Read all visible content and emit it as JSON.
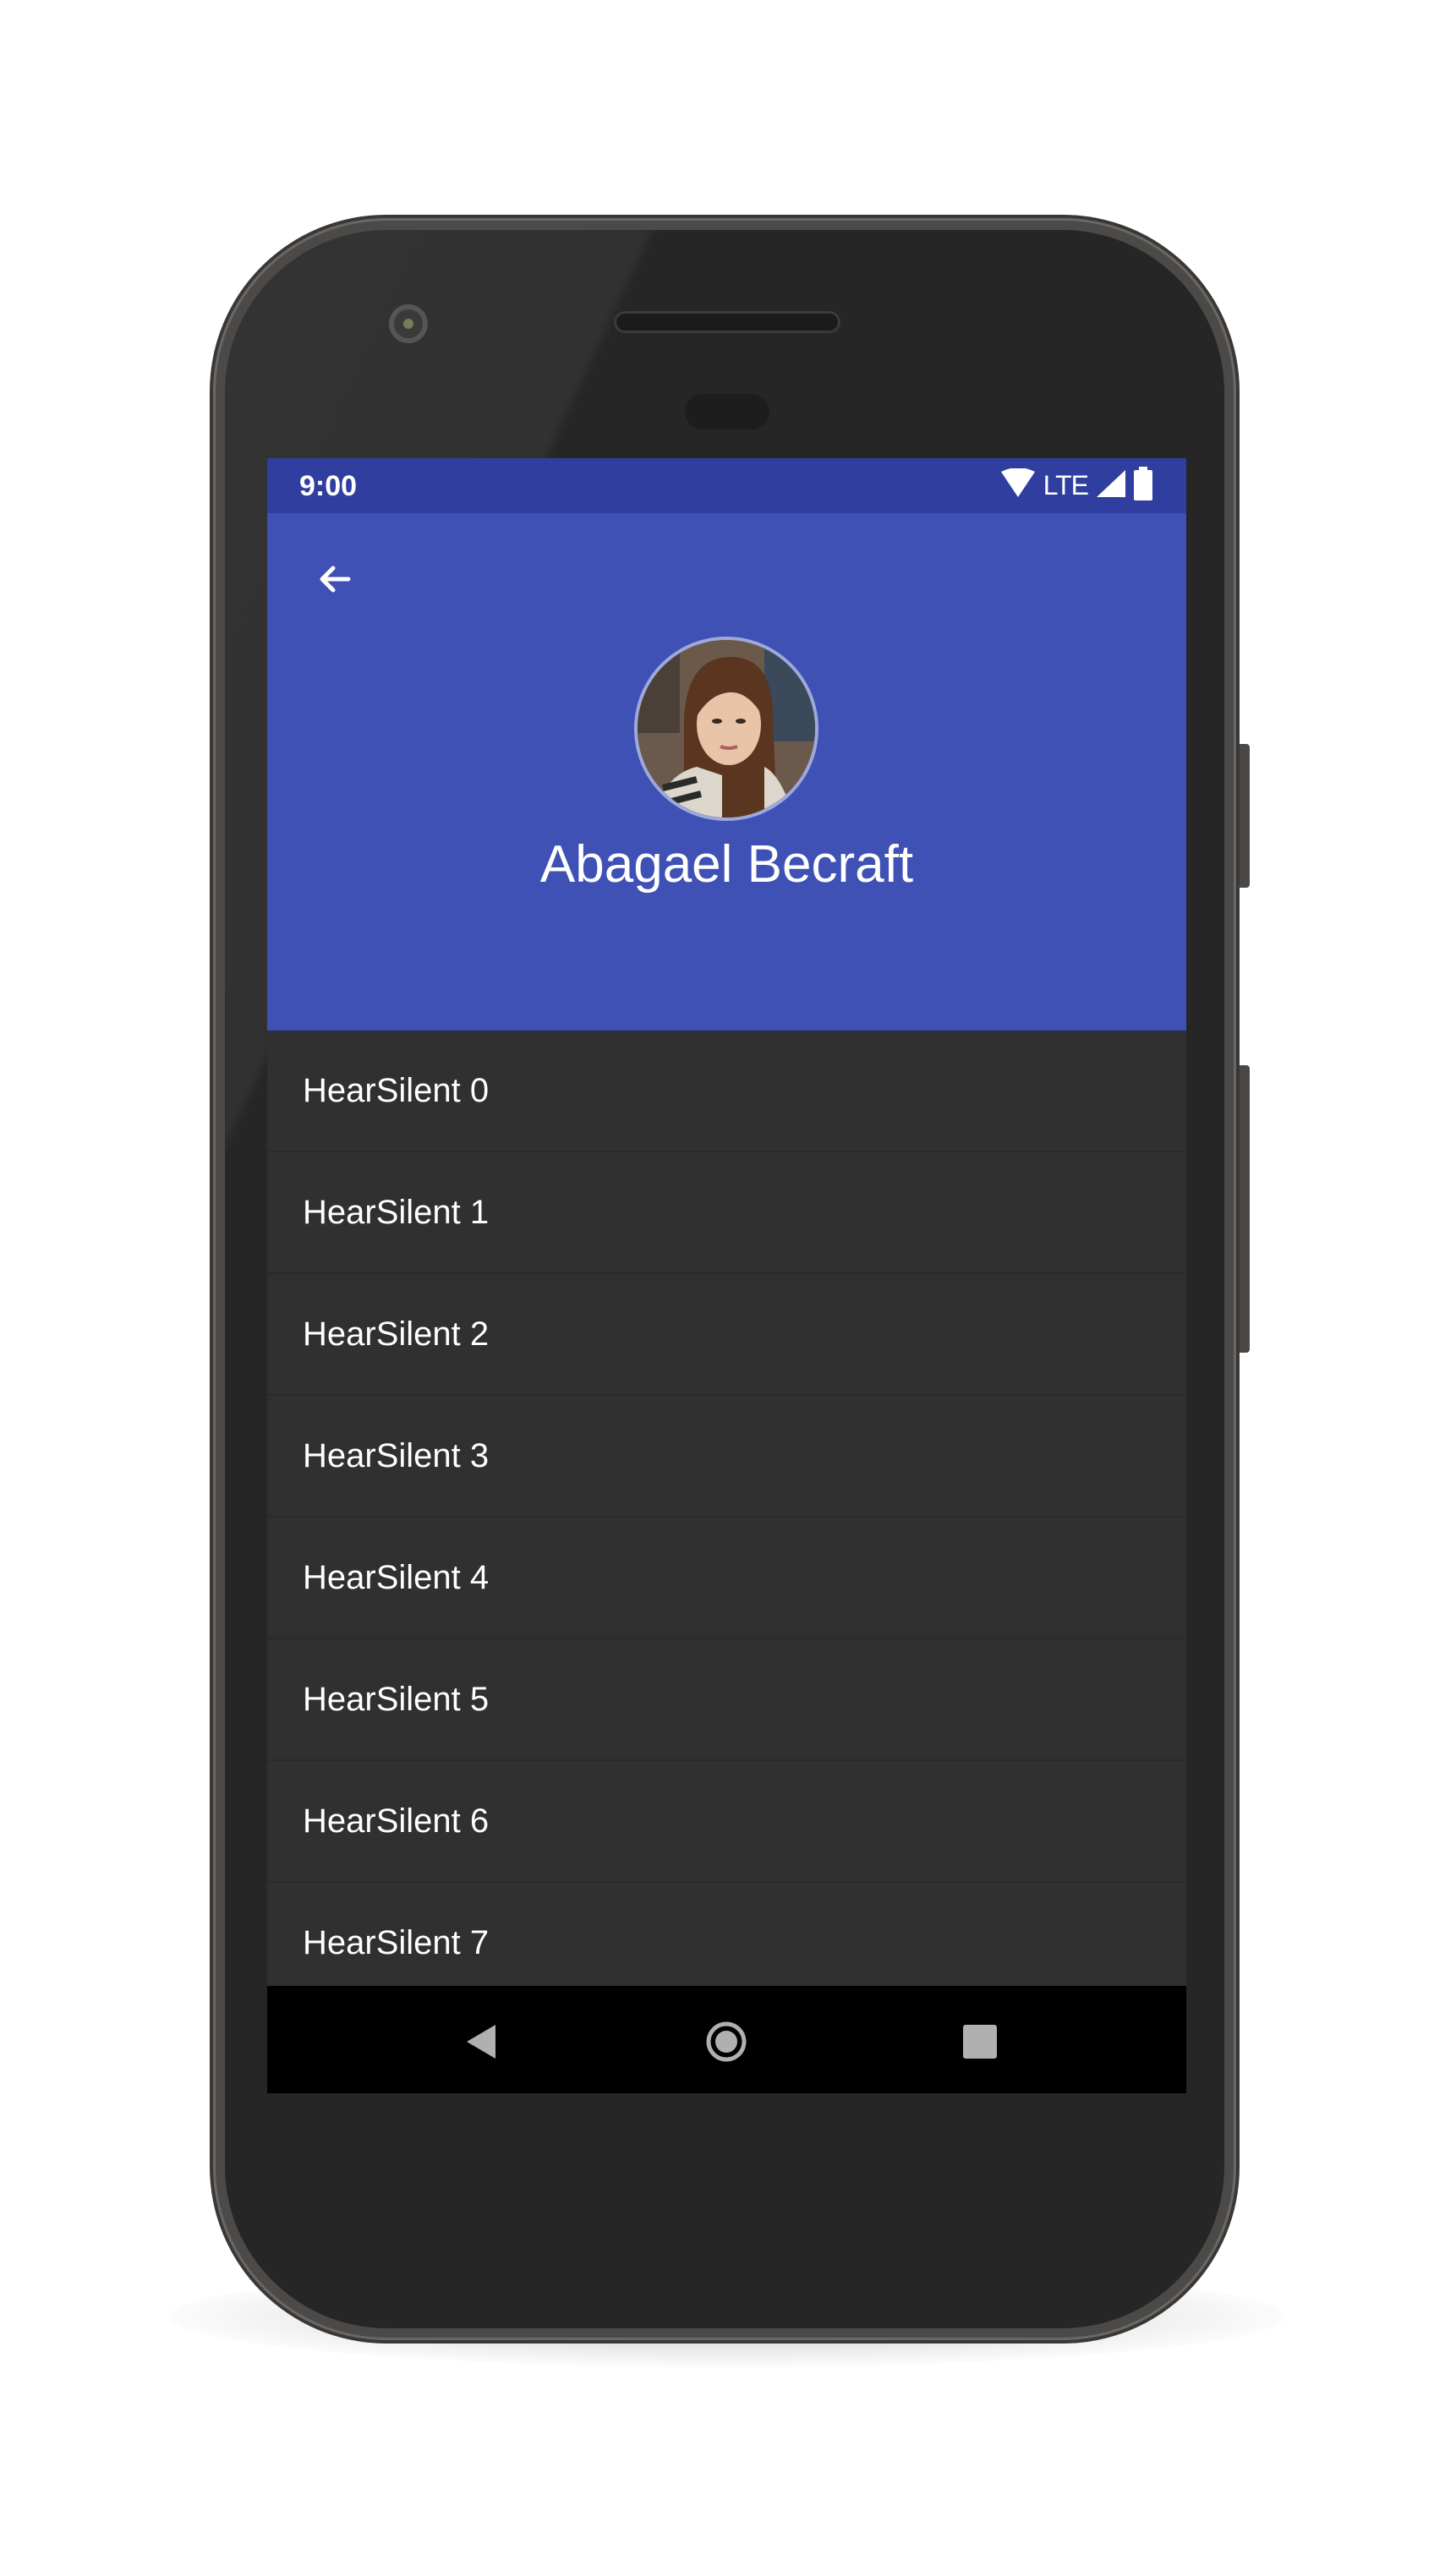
{
  "status_bar": {
    "time": "9:00",
    "network": "LTE",
    "icons": [
      "wifi-icon",
      "signal-icon",
      "battery-icon"
    ]
  },
  "header": {
    "back_icon": "arrow-back-icon",
    "profile_name": "Abagael Becraft",
    "background_color": "#3f51b5",
    "status_bar_color": "#303f9f"
  },
  "list": {
    "items": [
      {
        "label": "HearSilent 0"
      },
      {
        "label": "HearSilent 1"
      },
      {
        "label": "HearSilent 2"
      },
      {
        "label": "HearSilent 3"
      },
      {
        "label": "HearSilent 4"
      },
      {
        "label": "HearSilent 5"
      },
      {
        "label": "HearSilent 6"
      },
      {
        "label": "HearSilent 7"
      }
    ],
    "background_color": "#303030"
  },
  "navigation_bar": {
    "buttons": [
      "nav-back-icon",
      "nav-home-icon",
      "nav-recents-icon"
    ]
  }
}
